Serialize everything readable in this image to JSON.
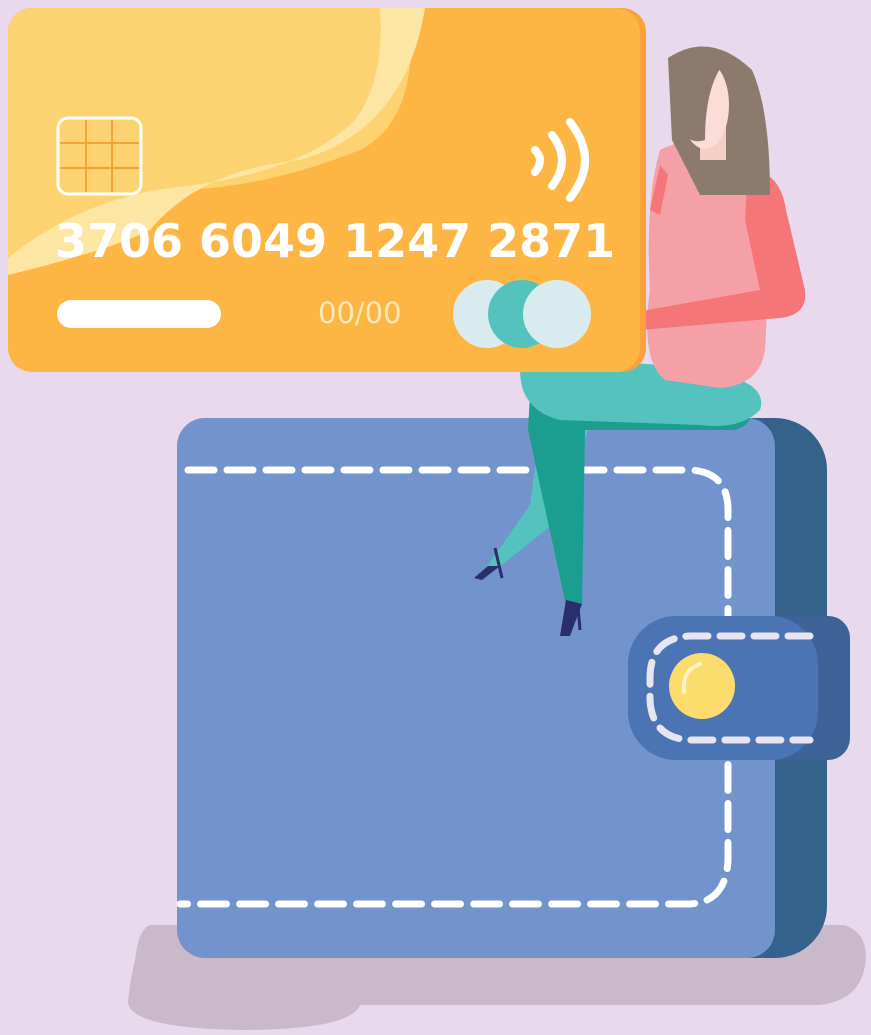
{
  "card": {
    "number": "3706  6049 1247 2871",
    "expiry": "00/00"
  },
  "icons": [
    "chip-icon",
    "contactless-icon",
    "card-brand-icon"
  ],
  "colors": {
    "background": "#e8daec",
    "card": "#fdb543",
    "wallet": "#7293cb",
    "wallet_shadow": "#35628b",
    "clasp": "#4a74b4",
    "button": "#fddc6e"
  }
}
